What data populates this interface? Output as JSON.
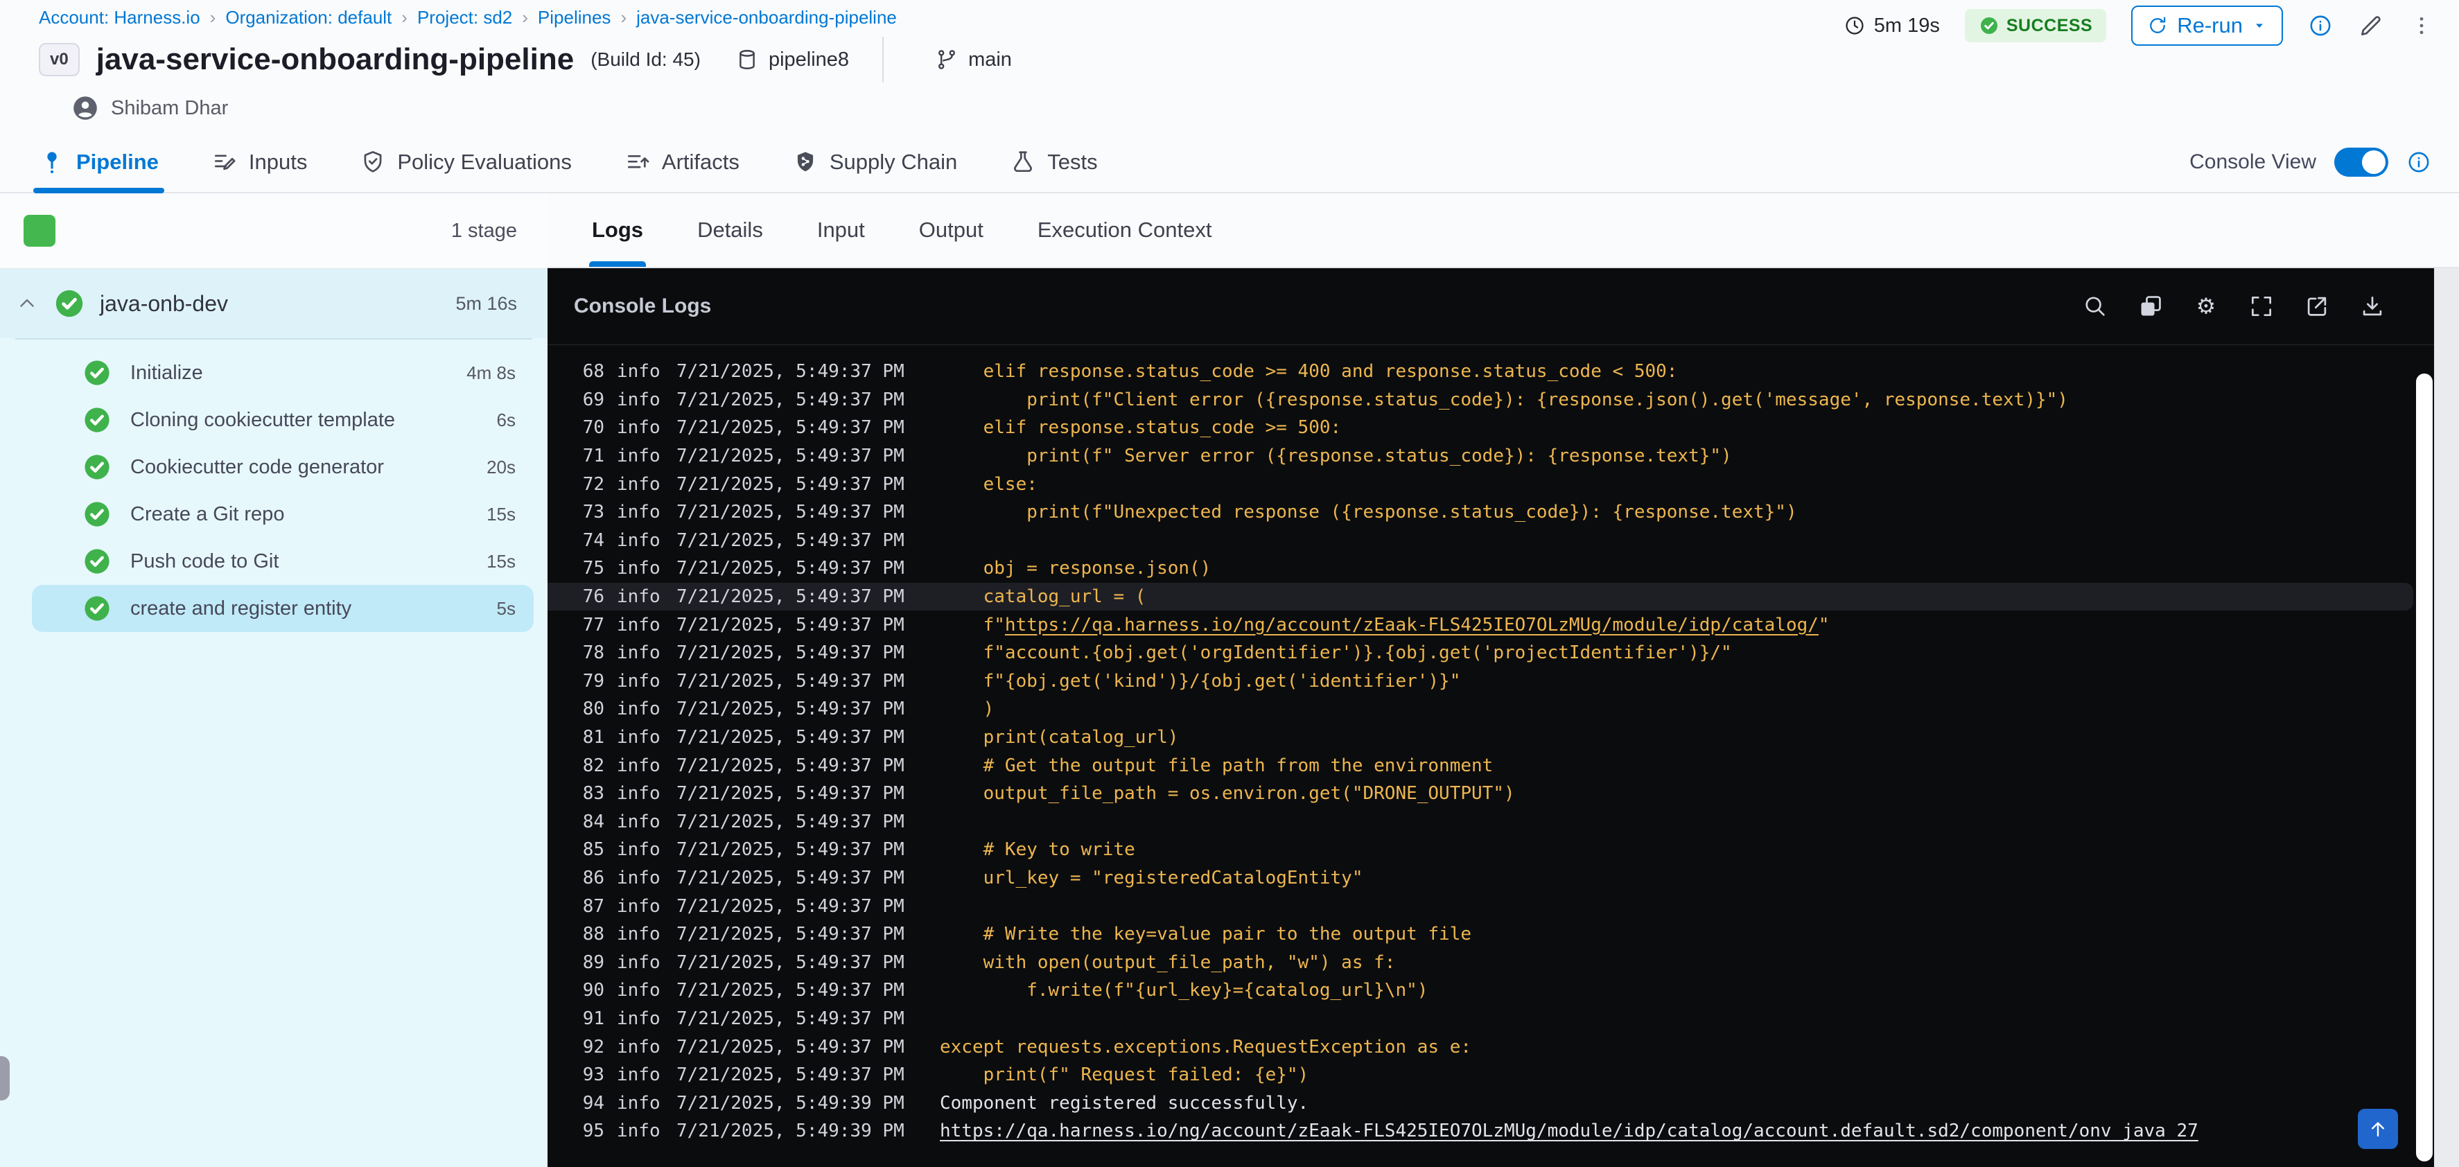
{
  "breadcrumb": {
    "separator": "›",
    "items": [
      "Account: Harness.io",
      "Organization: default",
      "Project: sd2",
      "Pipelines",
      "java-service-onboarding-pipeline"
    ]
  },
  "header": {
    "version_badge": "v0",
    "title": "java-service-onboarding-pipeline",
    "build_id": "(Build Id: 45)",
    "pipeline_ref": "pipeline8",
    "branch": "main",
    "author": "Shibam Dhar",
    "duration": "5m 19s",
    "status": "SUCCESS",
    "rerun_label": "Re-run"
  },
  "tabs": {
    "console_view_label": "Console View",
    "console_view_on": true,
    "items": [
      {
        "label": "Pipeline",
        "icon": "pipeline-icon",
        "active": true
      },
      {
        "label": "Inputs",
        "icon": "inputs-icon",
        "active": false
      },
      {
        "label": "Policy Evaluations",
        "icon": "policy-icon",
        "active": false
      },
      {
        "label": "Artifacts",
        "icon": "artifacts-icon",
        "active": false
      },
      {
        "label": "Supply Chain",
        "icon": "supply-chain-icon",
        "active": false
      },
      {
        "label": "Tests",
        "icon": "tests-icon",
        "active": false
      }
    ]
  },
  "sidebar": {
    "stage_count": "1 stage",
    "stage": {
      "name": "java-onb-dev",
      "duration": "5m 16s"
    },
    "steps": [
      {
        "name": "Initialize",
        "duration": "4m 8s",
        "selected": false
      },
      {
        "name": "Cloning cookiecutter template",
        "duration": "6s",
        "selected": false
      },
      {
        "name": "Cookiecutter code generator",
        "duration": "20s",
        "selected": false
      },
      {
        "name": "Create a Git repo",
        "duration": "15s",
        "selected": false
      },
      {
        "name": "Push code to Git",
        "duration": "15s",
        "selected": false
      },
      {
        "name": "create and register entity",
        "duration": "5s",
        "selected": true
      }
    ]
  },
  "console": {
    "title": "Console Logs",
    "tabs": [
      {
        "label": "Logs",
        "active": true
      },
      {
        "label": "Details",
        "active": false
      },
      {
        "label": "Input",
        "active": false
      },
      {
        "label": "Output",
        "active": false
      },
      {
        "label": "Execution Context",
        "active": false
      }
    ],
    "toolbar_icons": [
      "search-icon",
      "copy-icon",
      "settings-icon",
      "fullscreen-icon",
      "open-in-new-icon",
      "download-icon"
    ],
    "colors": {
      "accent": "#0278d5",
      "code_text": "#edb64f",
      "plain_text": "#e3e4ea",
      "success_green": "#44b84e",
      "console_bg": "#0b0c0e"
    },
    "logs": [
      {
        "num": 68,
        "level": "info",
        "time": "7/21/2025, 5:49:37 PM",
        "color": "code",
        "highlight": false,
        "pre": "    elif response.status_code >= 400 and response.status_code < 500:"
      },
      {
        "num": 69,
        "level": "info",
        "time": "7/21/2025, 5:49:37 PM",
        "color": "code",
        "highlight": false,
        "pre": "        print(f\"Client error ({response.status_code}): {response.json().get('message', response.text)}\")"
      },
      {
        "num": 70,
        "level": "info",
        "time": "7/21/2025, 5:49:37 PM",
        "color": "code",
        "highlight": false,
        "pre": "    elif response.status_code >= 500:"
      },
      {
        "num": 71,
        "level": "info",
        "time": "7/21/2025, 5:49:37 PM",
        "color": "code",
        "highlight": false,
        "pre": "        print(f\" Server error ({response.status_code}): {response.text}\")"
      },
      {
        "num": 72,
        "level": "info",
        "time": "7/21/2025, 5:49:37 PM",
        "color": "code",
        "highlight": false,
        "pre": "    else:"
      },
      {
        "num": 73,
        "level": "info",
        "time": "7/21/2025, 5:49:37 PM",
        "color": "code",
        "highlight": false,
        "pre": "        print(f\"Unexpected response ({response.status_code}): {response.text}\")"
      },
      {
        "num": 74,
        "level": "info",
        "time": "7/21/2025, 5:49:37 PM",
        "color": "code",
        "highlight": false,
        "pre": ""
      },
      {
        "num": 75,
        "level": "info",
        "time": "7/21/2025, 5:49:37 PM",
        "color": "code",
        "highlight": false,
        "pre": "    obj = response.json()"
      },
      {
        "num": 76,
        "level": "info",
        "time": "7/21/2025, 5:49:37 PM",
        "color": "code",
        "highlight": true,
        "pre": "    catalog_url = ("
      },
      {
        "num": 77,
        "level": "info",
        "time": "7/21/2025, 5:49:37 PM",
        "color": "code",
        "highlight": false,
        "pre": "    f\"",
        "link": "https://qa.harness.io/ng/account/zEaak-FLS425IEO7OLzMUg/module/idp/catalog/",
        "post": "\""
      },
      {
        "num": 78,
        "level": "info",
        "time": "7/21/2025, 5:49:37 PM",
        "color": "code",
        "highlight": false,
        "pre": "    f\"account.{obj.get('orgIdentifier')}.{obj.get('projectIdentifier')}/\""
      },
      {
        "num": 79,
        "level": "info",
        "time": "7/21/2025, 5:49:37 PM",
        "color": "code",
        "highlight": false,
        "pre": "    f\"{obj.get('kind')}/{obj.get('identifier')}\""
      },
      {
        "num": 80,
        "level": "info",
        "time": "7/21/2025, 5:49:37 PM",
        "color": "code",
        "highlight": false,
        "pre": "    )"
      },
      {
        "num": 81,
        "level": "info",
        "time": "7/21/2025, 5:49:37 PM",
        "color": "code",
        "highlight": false,
        "pre": "    print(catalog_url)"
      },
      {
        "num": 82,
        "level": "info",
        "time": "7/21/2025, 5:49:37 PM",
        "color": "code",
        "highlight": false,
        "pre": "    # Get the output file path from the environment"
      },
      {
        "num": 83,
        "level": "info",
        "time": "7/21/2025, 5:49:37 PM",
        "color": "code",
        "highlight": false,
        "pre": "    output_file_path = os.environ.get(\"DRONE_OUTPUT\")"
      },
      {
        "num": 84,
        "level": "info",
        "time": "7/21/2025, 5:49:37 PM",
        "color": "code",
        "highlight": false,
        "pre": ""
      },
      {
        "num": 85,
        "level": "info",
        "time": "7/21/2025, 5:49:37 PM",
        "color": "code",
        "highlight": false,
        "pre": "    # Key to write"
      },
      {
        "num": 86,
        "level": "info",
        "time": "7/21/2025, 5:49:37 PM",
        "color": "code",
        "highlight": false,
        "pre": "    url_key = \"registeredCatalogEntity\""
      },
      {
        "num": 87,
        "level": "info",
        "time": "7/21/2025, 5:49:37 PM",
        "color": "code",
        "highlight": false,
        "pre": ""
      },
      {
        "num": 88,
        "level": "info",
        "time": "7/21/2025, 5:49:37 PM",
        "color": "code",
        "highlight": false,
        "pre": "    # Write the key=value pair to the output file"
      },
      {
        "num": 89,
        "level": "info",
        "time": "7/21/2025, 5:49:37 PM",
        "color": "code",
        "highlight": false,
        "pre": "    with open(output_file_path, \"w\") as f:"
      },
      {
        "num": 90,
        "level": "info",
        "time": "7/21/2025, 5:49:37 PM",
        "color": "code",
        "highlight": false,
        "pre": "        f.write(f\"{url_key}={catalog_url}\\n\")"
      },
      {
        "num": 91,
        "level": "info",
        "time": "7/21/2025, 5:49:37 PM",
        "color": "code",
        "highlight": false,
        "pre": ""
      },
      {
        "num": 92,
        "level": "info",
        "time": "7/21/2025, 5:49:37 PM",
        "color": "code",
        "highlight": false,
        "pre": "except requests.exceptions.RequestException as e:"
      },
      {
        "num": 93,
        "level": "info",
        "time": "7/21/2025, 5:49:37 PM",
        "color": "code",
        "highlight": false,
        "pre": "    print(f\" Request failed: {e}\")"
      },
      {
        "num": 94,
        "level": "info",
        "time": "7/21/2025, 5:49:39 PM",
        "color": "plain",
        "highlight": false,
        "pre": "Component registered successfully."
      },
      {
        "num": 95,
        "level": "info",
        "time": "7/21/2025, 5:49:39 PM",
        "color": "plain",
        "highlight": false,
        "pre": "",
        "link": "https://qa.harness.io/ng/account/zEaak-FLS425IEO7OLzMUg/module/idp/catalog/account.default.sd2/component/onv_java_27",
        "post": ""
      }
    ]
  }
}
